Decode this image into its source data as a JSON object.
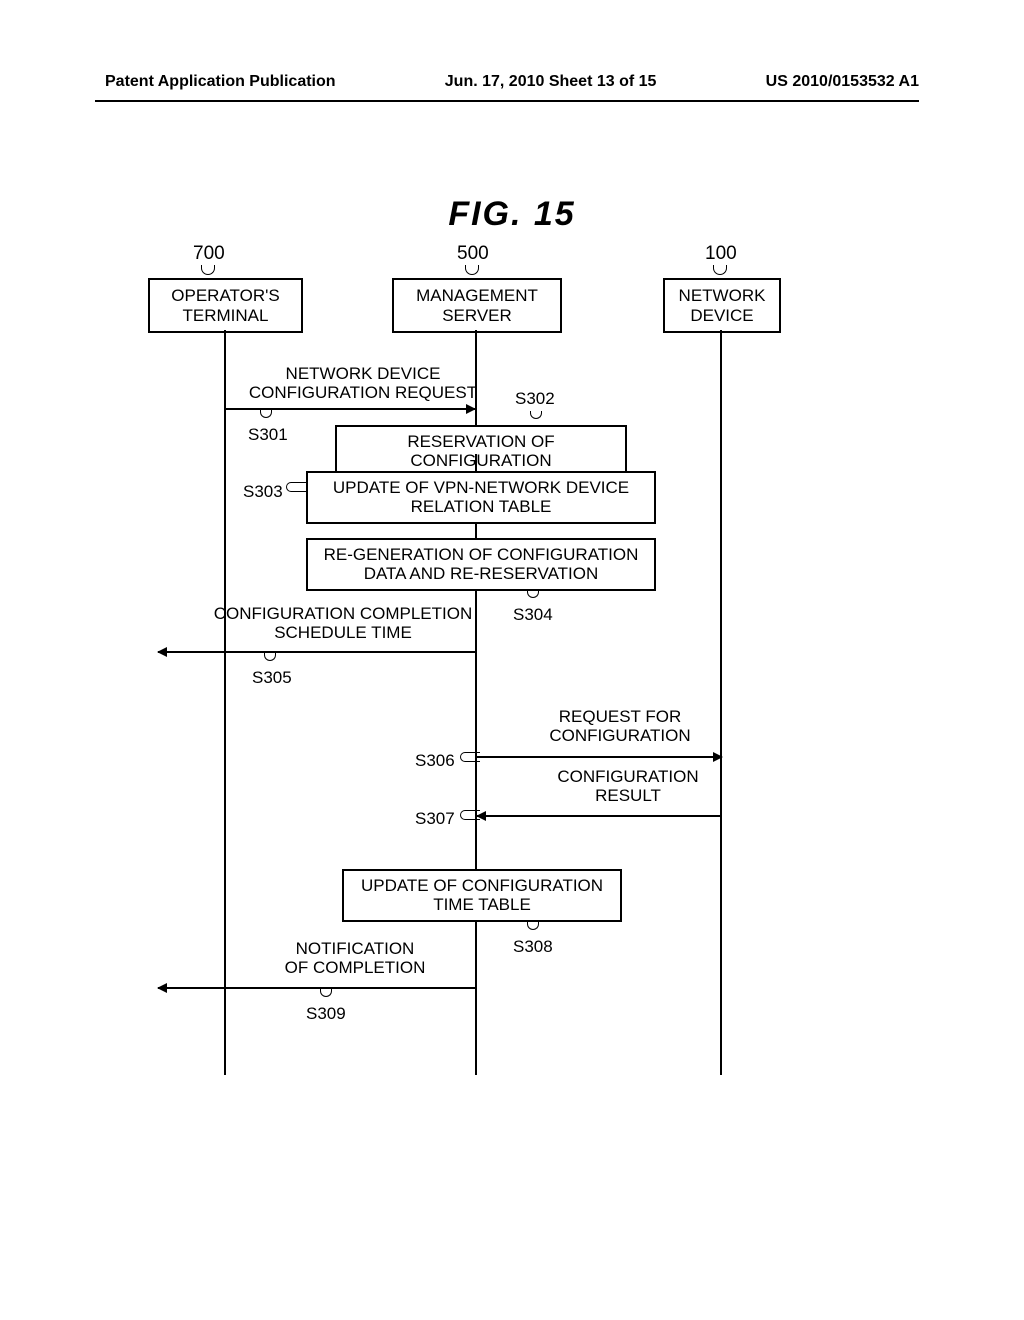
{
  "header": {
    "left": "Patent Application Publication",
    "center": "Jun. 17, 2010  Sheet 13 of 15",
    "right": "US 2010/0153532 A1"
  },
  "figure": {
    "title": "FIG.  15"
  },
  "lifelines": {
    "operator": {
      "id": "700",
      "label": "OPERATOR'S\nTERMINAL"
    },
    "server": {
      "id": "500",
      "label": "MANAGEMENT\nSERVER"
    },
    "device": {
      "id": "100",
      "label": "NETWORK\nDEVICE"
    }
  },
  "steps": {
    "s301": {
      "id": "S301",
      "label": "NETWORK DEVICE\nCONFIGURATION REQUEST"
    },
    "s302": {
      "id": "S302",
      "label": "RESERVATION OF CONFIGURATION"
    },
    "s303": {
      "id": "S303",
      "label": "UPDATE OF VPN-NETWORK DEVICE\nRELATION TABLE"
    },
    "s304": {
      "id": "S304",
      "label": "RE-GENERATION OF CONFIGURATION\nDATA AND RE-RESERVATION"
    },
    "s305": {
      "id": "S305",
      "label": "CONFIGURATION COMPLETION\nSCHEDULE TIME"
    },
    "s306": {
      "id": "S306",
      "label": "REQUEST FOR\nCONFIGURATION"
    },
    "s307": {
      "id": "S307",
      "label": "CONFIGURATION\nRESULT"
    },
    "s308": {
      "id": "S308",
      "label": "UPDATE OF CONFIGURATION\nTIME TABLE"
    },
    "s309": {
      "id": "S309",
      "label": "NOTIFICATION\nOF COMPLETION"
    }
  }
}
